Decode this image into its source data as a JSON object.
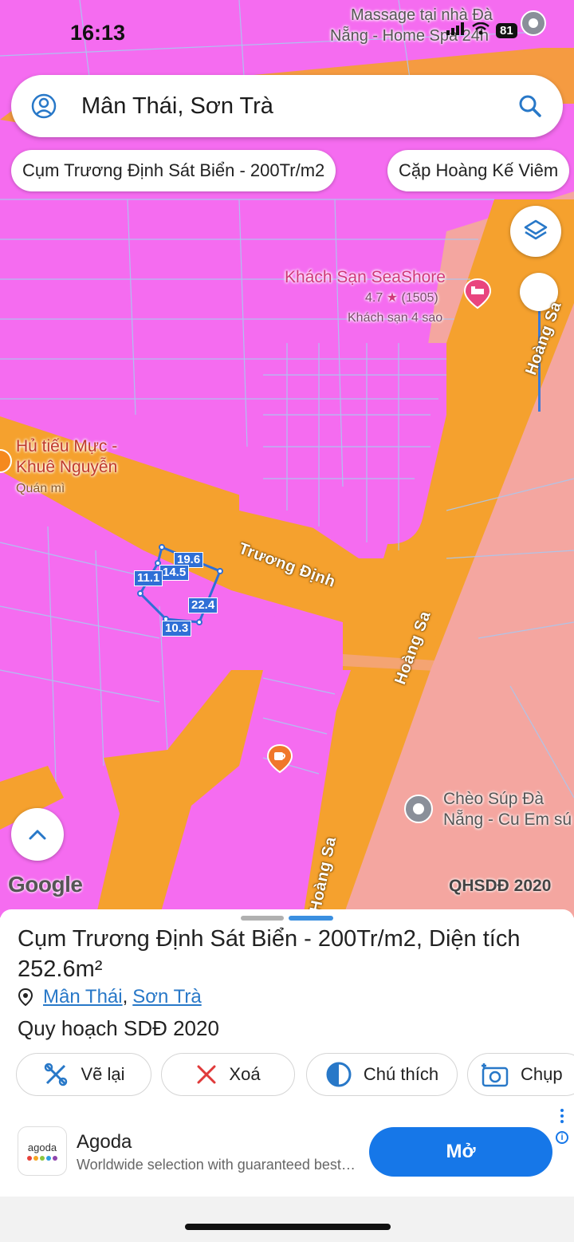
{
  "status_bar": {
    "time": "16:13",
    "battery": "81"
  },
  "search": {
    "query": "Mân Thái, Sơn Trà"
  },
  "chips": [
    "Cụm Trương Định Sát Biển - 200Tr/m2",
    "Cặp Hoàng Kế Viêm"
  ],
  "map": {
    "poi_massage": [
      "Massage tại nhà Đà",
      "Nẵng - Home Spa 24h"
    ],
    "hotel": {
      "name": "Khách Sạn SeaShore",
      "rating": "4.7",
      "reviews": "(1505)",
      "category": "Khách sạn 4 sao"
    },
    "restaurant": {
      "name_line1": "Hủ tiếu Mực -",
      "name_line2": "Khuê Nguyễn",
      "category": "Quán mì"
    },
    "poi_cheo": [
      "Chèo Súp Đà",
      "Nẵng - Cu Em sú"
    ],
    "roads": {
      "truong_dinh": "Trương Định",
      "hoang_sa": "Hoàng Sa"
    },
    "measurements": [
      "19.6",
      "14.5",
      "11.1",
      "22.4",
      "10.3"
    ],
    "google_logo": "Google",
    "layer_label": "QHSDĐ 2020"
  },
  "sheet": {
    "title": "Cụm Trương Định Sát Biển - 200Tr/m2, Diện tích 252.6m²",
    "location_ward": "Mân Thái",
    "location_district": "Sơn Trà",
    "location_sep": ",",
    "plan": "Quy hoạch SDĐ 2020",
    "actions": [
      {
        "label": "Vẽ lại",
        "icon": "redraw-icon"
      },
      {
        "label": "Xoá",
        "icon": "close-icon"
      },
      {
        "label": "Chú thích",
        "icon": "legend-icon"
      },
      {
        "label": "Chụp",
        "icon": "camera-icon"
      }
    ]
  },
  "ad": {
    "brand_word": "agoda",
    "title": "Agoda",
    "description": "Worldwide selection with guaranteed best prices",
    "cta": "Mở",
    "info": "i"
  },
  "colors": {
    "residential": "#f56cf0",
    "road": "#f5a12e",
    "public_land": "#f4a6a0",
    "parcel_line": "#a9c8f0",
    "measure_blue": "#2f6fd6",
    "accent": "#1677e8"
  }
}
